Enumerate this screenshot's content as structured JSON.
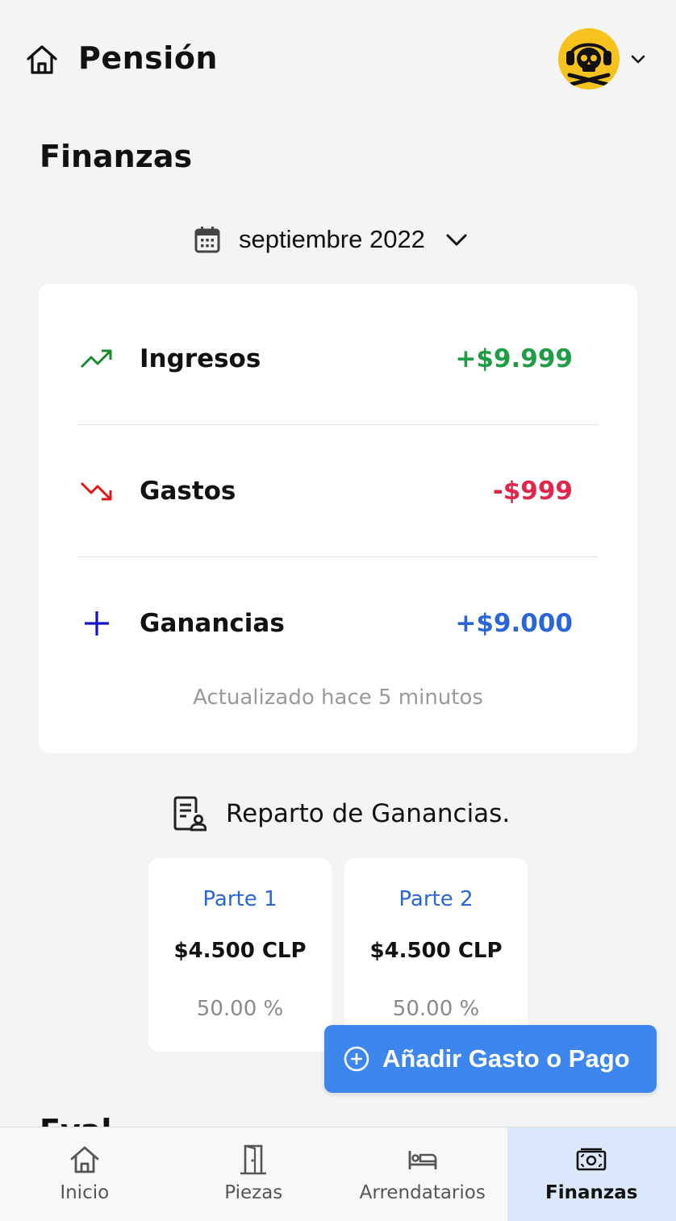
{
  "header": {
    "app_title": "Pensión",
    "home_icon": "home-icon",
    "avatar_icon": "skull-headphones-avatar",
    "menu_icon": "chevron-down-icon"
  },
  "page": {
    "title": "Finanzas"
  },
  "month_picker": {
    "icon": "calendar-icon",
    "label": "septiembre 2022",
    "chevron": "chevron-down-icon"
  },
  "summary": {
    "rows": [
      {
        "label": "Ingresos",
        "value": "+$9.999",
        "icon": "trending-up-icon",
        "color": "#1f9d45"
      },
      {
        "label": "Gastos",
        "value": "-$999",
        "icon": "trending-down-icon",
        "color": "#e0264b"
      },
      {
        "label": "Ganancias",
        "value": "+$9.000",
        "icon": "plus-icon",
        "color": "#2a66d9"
      }
    ],
    "updated_text": "Actualizado hace 5 minutos"
  },
  "profit_split": {
    "title": "Reparto de Ganancias.",
    "icon": "document-person-icon",
    "parts": [
      {
        "name": "Parte 1",
        "amount": "$4.500 CLP",
        "percent": "50.00 %"
      },
      {
        "name": "Parte 2",
        "amount": "$4.500 CLP",
        "percent": "50.00 %"
      }
    ]
  },
  "next_section": {
    "partial_title": "Eval"
  },
  "fab": {
    "label": "Añadir Gasto o Pago",
    "icon": "plus-circle-icon"
  },
  "bottom_nav": {
    "items": [
      {
        "label": "Inicio",
        "icon": "home-icon"
      },
      {
        "label": "Piezas",
        "icon": "door-icon"
      },
      {
        "label": "Arrendatarios",
        "icon": "bed-icon"
      },
      {
        "label": "Finanzas",
        "icon": "money-icon",
        "active": true
      }
    ]
  },
  "colors": {
    "accent": "#3d86ee",
    "income": "#1f9d45",
    "expense": "#e0264b",
    "profit": "#2a66d9",
    "avatar_bg": "#f7c21e",
    "nav_active_bg": "#dbe7fb"
  }
}
